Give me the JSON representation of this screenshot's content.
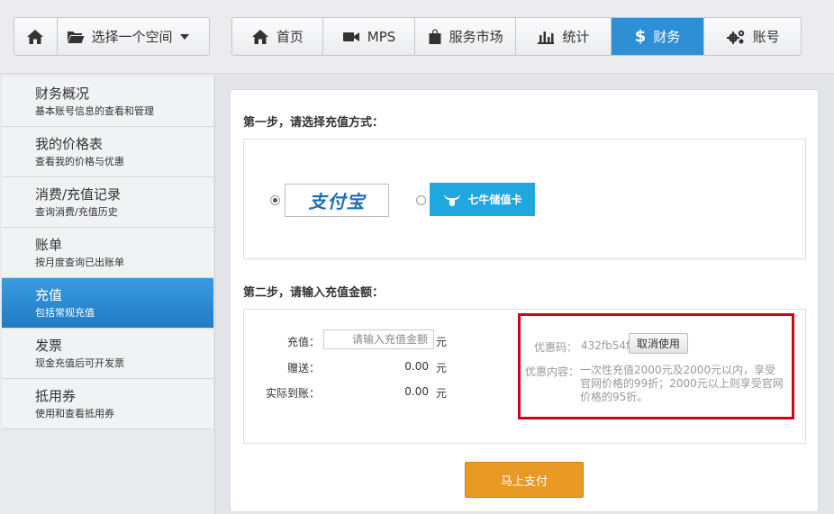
{
  "header": {
    "space_selector": "选择一个空间",
    "nav": [
      {
        "label": "首页"
      },
      {
        "label": "MPS"
      },
      {
        "label": "服务市场"
      },
      {
        "label": "统计"
      },
      {
        "label": "财务"
      },
      {
        "label": "账号"
      }
    ],
    "active_nav": "财务",
    "accent_color": "#2f8fd5"
  },
  "sidebar": {
    "items": [
      {
        "title": "财务概况",
        "subtitle": "基本账号信息的查看和管理"
      },
      {
        "title": "我的价格表",
        "subtitle": "查看我的价格与优惠"
      },
      {
        "title": "消费/充值记录",
        "subtitle": "查询消费/充值历史"
      },
      {
        "title": "账单",
        "subtitle": "按月度查询已出账单"
      },
      {
        "title": "充值",
        "subtitle": "包括常规充值"
      },
      {
        "title": "发票",
        "subtitle": "现金充值后可开发票"
      },
      {
        "title": "抵用券",
        "subtitle": "使用和查看抵用券"
      }
    ],
    "active_item": "充值"
  },
  "main": {
    "step1_title": "第一步，请选择充值方式：",
    "payment_methods": [
      {
        "name": "支付宝",
        "selected": true
      },
      {
        "name": "七牛储值卡",
        "selected": false
      }
    ],
    "step2_title": "第二步，请输入充值金额：",
    "form": {
      "recharge_label": "充值：",
      "recharge_placeholder": "请输入充值金额",
      "recharge_unit": "元",
      "bonus_label": "赠送：",
      "bonus_value": "0.00",
      "bonus_unit": "元",
      "actual_label": "实际到账：",
      "actual_value": "0.00",
      "actual_unit": "元"
    },
    "coupon": {
      "code_label": "优惠码：",
      "code_value": "432fb54f",
      "cancel_label": "取消使用",
      "content_label": "优惠内容：",
      "content_text": "一次性充值2000元及2000元以内，享受官网价格的99折；2000元以上则享受官网价格的95折。"
    },
    "pay_button": "马上支付"
  }
}
